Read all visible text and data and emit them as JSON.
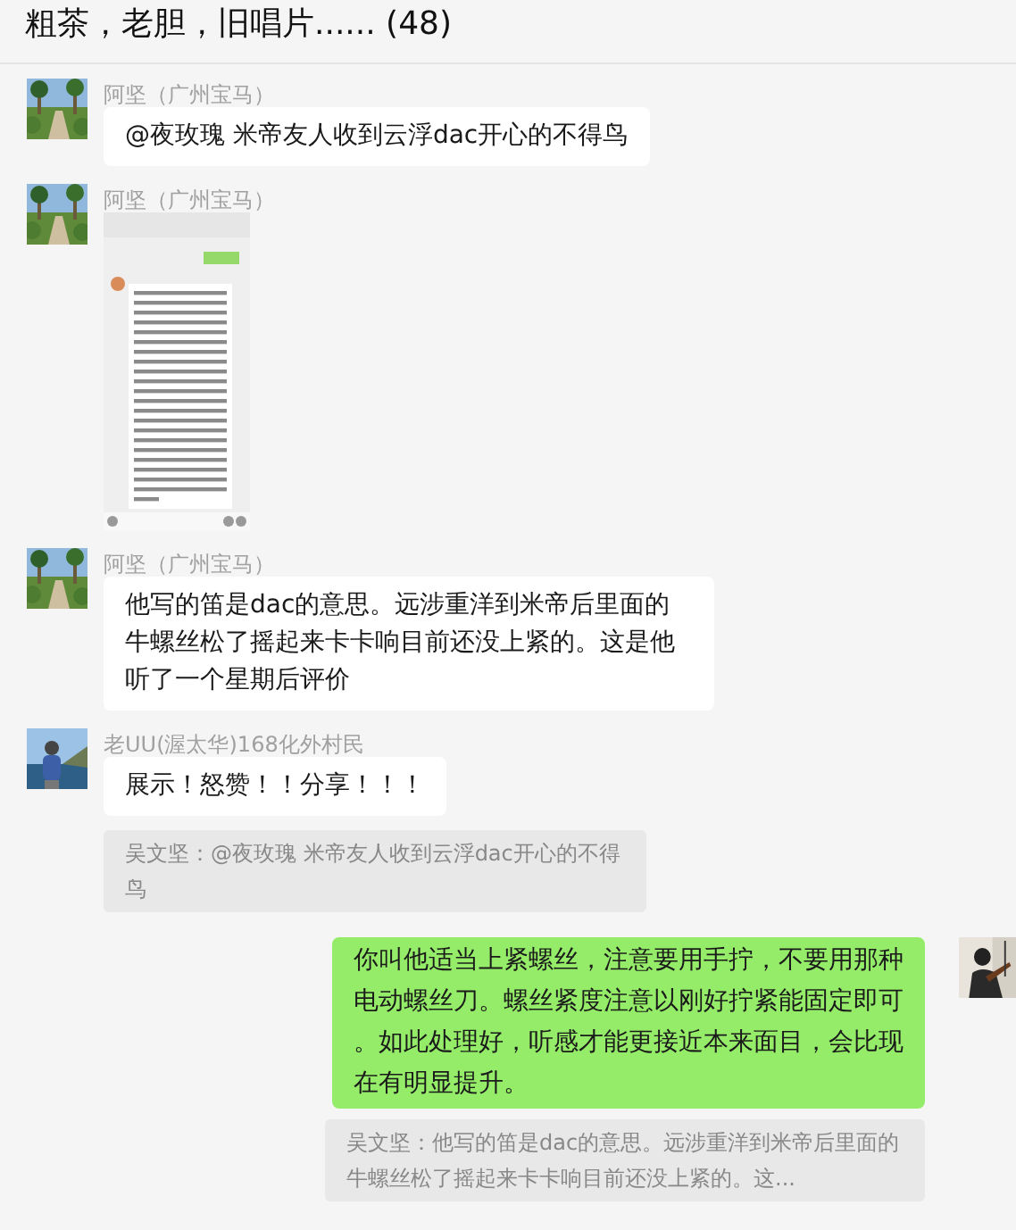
{
  "chat": {
    "title": "粗茶，老胆，旧唱片...... (48)"
  },
  "messages": [
    {
      "kind": "text",
      "outgoing": false,
      "sender": "阿坚（广州宝马）",
      "text": "@夜玫瑰 米帝友人收到云浮dac开心的不得鸟"
    },
    {
      "outgoing": false,
      "sender": "阿坚（广州宝马）"
    },
    {
      "kind": "text",
      "outgoing": false,
      "sender": "阿坚（广州宝马）",
      "text": "他写的笛是dac的意思。远涉重洋到米帝后里面的牛螺丝松了摇起来卡卡响目前还没上紧的。这是他听了一个星期后评价"
    },
    {
      "kind": "text",
      "outgoing": false,
      "sender": "老UU(渥太华)168化外村民",
      "text": "展示！怒赞！！分享！！！",
      "quote": "吴文坚：@夜玫瑰 米帝友人收到云浮dac开心的不得鸟"
    },
    {
      "kind": "text",
      "outgoing": true,
      "text": "你叫他适当上紧螺丝，注意要用手拧，不要用那种电动螺丝刀。螺丝紧度注意以刚好拧紧能固定即可。如此处理好，听感才能更接近本来面目，会比现在有明显提升。",
      "quote": "吴文坚：他写的笛是dac的意思。远涉重洋到米帝后里面的牛螺丝松了摇起来卡卡响目前还没上紧的。这..."
    }
  ]
}
